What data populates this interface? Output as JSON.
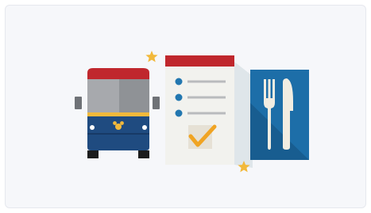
{
  "illustration": {
    "icons": [
      "bus-icon",
      "checklist-icon",
      "fork-knife-icon",
      "star-icon",
      "star-icon"
    ],
    "colors": {
      "background": "#f6f7fa",
      "bus_red": "#c0272d",
      "bus_gray": "#a7a9ad",
      "bus_navy": "#1f4b80",
      "bus_yellow": "#f2b93b",
      "checklist_red": "#c0272d",
      "checklist_paper": "#f2f2ee",
      "checklist_blue": "#2277b0",
      "checkmark_orange": "#f0a423",
      "dining_blue": "#1d6ea8",
      "star_yellow": "#f2b93b"
    }
  }
}
